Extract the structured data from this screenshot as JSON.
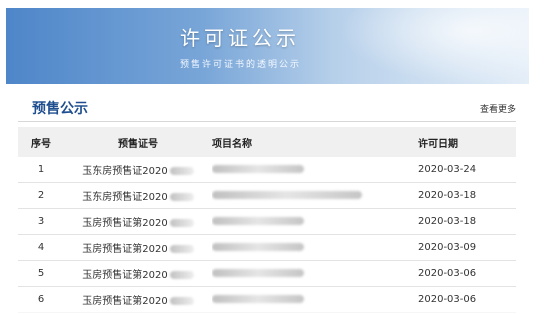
{
  "banner": {
    "title": "许可证公示",
    "subtitle": "预售许可证书的透明公示"
  },
  "section": {
    "title": "预售公示",
    "more_link": "查看更多"
  },
  "table": {
    "headers": {
      "idx": "序号",
      "cert": "预售证号",
      "name": "项目名称",
      "date": "许可日期"
    },
    "rows": [
      {
        "idx": "1",
        "cert": "玉东房预售证2020",
        "date": "2020-03-24"
      },
      {
        "idx": "2",
        "cert": "玉东房预售证2020",
        "date": "2020-03-18"
      },
      {
        "idx": "3",
        "cert": "玉房预售证第2020",
        "date": "2020-03-18"
      },
      {
        "idx": "4",
        "cert": "玉房预售证第2020",
        "date": "2020-03-09"
      },
      {
        "idx": "5",
        "cert": "玉房预售证第2020",
        "date": "2020-03-06"
      },
      {
        "idx": "6",
        "cert": "玉房预售证第2020",
        "date": "2020-03-06"
      }
    ]
  }
}
